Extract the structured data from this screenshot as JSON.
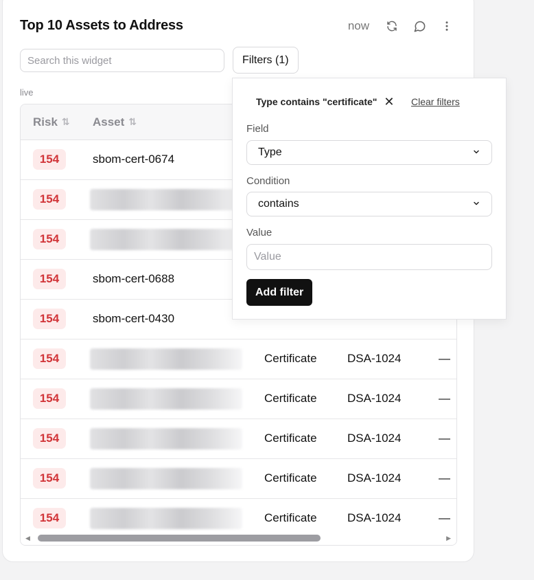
{
  "widget": {
    "title": "Top 10 Assets to Address",
    "updated": "now",
    "search_placeholder": "Search this widget",
    "filters_label": "Filters (1)",
    "live_label": "live"
  },
  "table": {
    "columns": [
      "Risk",
      "Asset"
    ],
    "rows": [
      {
        "risk": "154",
        "asset": "sbom-cert-0674",
        "type": "",
        "algorithm": "",
        "extra": ""
      },
      {
        "risk": "154",
        "asset": "",
        "type": "",
        "algorithm": "",
        "extra": ""
      },
      {
        "risk": "154",
        "asset": "",
        "type": "",
        "algorithm": "",
        "extra": ""
      },
      {
        "risk": "154",
        "asset": "sbom-cert-0688",
        "type": "",
        "algorithm": "",
        "extra": ""
      },
      {
        "risk": "154",
        "asset": "sbom-cert-0430",
        "type": "",
        "algorithm": "",
        "extra": ""
      },
      {
        "risk": "154",
        "asset": "",
        "type": "Certificate",
        "algorithm": "DSA-1024",
        "extra": "—"
      },
      {
        "risk": "154",
        "asset": "",
        "type": "Certificate",
        "algorithm": "DSA-1024",
        "extra": "—"
      },
      {
        "risk": "154",
        "asset": "",
        "type": "Certificate",
        "algorithm": "DSA-1024",
        "extra": "—"
      },
      {
        "risk": "154",
        "asset": "",
        "type": "Certificate",
        "algorithm": "DSA-1024",
        "extra": "—"
      },
      {
        "risk": "154",
        "asset": "",
        "type": "Certificate",
        "algorithm": "DSA-1024",
        "extra": "—"
      }
    ]
  },
  "filter_popover": {
    "active_filter": "Type contains \"certificate\"",
    "clear_label": "Clear filters",
    "field_label": "Field",
    "field_value": "Type",
    "condition_label": "Condition",
    "condition_value": "contains",
    "value_label": "Value",
    "value_placeholder": "Value",
    "add_label": "Add filter"
  },
  "icons": {
    "refresh": "refresh-icon",
    "comment": "comment-icon",
    "more": "more-vertical-icon",
    "sort": "sort-icon",
    "remove": "close-icon",
    "select": "chevron-down-icon"
  },
  "colors": {
    "risk_text": "#d13438",
    "risk_bg": "#fdeaea",
    "primary_button": "#111111"
  }
}
